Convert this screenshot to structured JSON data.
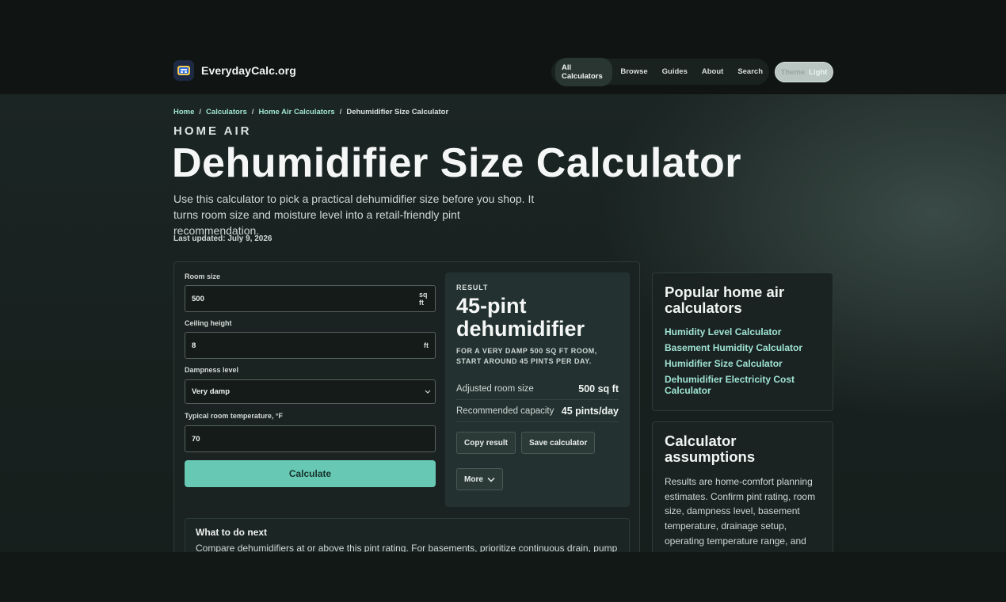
{
  "brand": {
    "name": "EverydayCalc.org"
  },
  "nav": {
    "items": [
      "All Calculators",
      "Browse",
      "Guides",
      "About",
      "Search"
    ],
    "theme_label": "Theme",
    "theme_value": "Light"
  },
  "breadcrumb": {
    "items": [
      "Home",
      "Calculators",
      "Home Air Calculators"
    ],
    "current": "Dehumidifier Size Calculator"
  },
  "hero": {
    "eyebrow": "HOME AIR",
    "title": "Dehumidifier Size Calculator",
    "lede": "Use this calculator to pick a practical dehumidifier size before you shop. It turns room size and moisture level into a retail-friendly pint recommendation.",
    "updated": "Last updated: July 9, 2026"
  },
  "form": {
    "room_size": {
      "label": "Room size",
      "value": "500",
      "unit": "sq ft"
    },
    "ceiling": {
      "label": "Ceiling height",
      "value": "8",
      "unit": "ft"
    },
    "dampness": {
      "label": "Dampness level",
      "value": "Very damp"
    },
    "temperature": {
      "label": "Typical room temperature, °F",
      "value": "70"
    },
    "calculate_label": "Calculate"
  },
  "result": {
    "label": "RESULT",
    "value": "45-pint dehumidifier",
    "note": "FOR A VERY DAMP 500 SQ FT ROOM, START AROUND 45 PINTS PER DAY.",
    "rows": [
      {
        "k": "Adjusted room size",
        "v": "500 sq ft"
      },
      {
        "k": "Recommended capacity",
        "v": "45 pints/day"
      }
    ],
    "copy_label": "Copy result",
    "save_label": "Save calculator",
    "more_label": "More"
  },
  "next": {
    "title": "What to do next",
    "text": "Compare dehumidifiers at or above this pint rating. For basements, prioritize continuous drain, pump"
  },
  "popular": {
    "title": "Popular home air calculators",
    "links": [
      "Humidity Level Calculator",
      "Basement Humidity Calculator",
      "Humidifier Size Calculator",
      "Dehumidifier Electricity Cost Calculator"
    ]
  },
  "assumptions": {
    "title": "Calculator assumptions",
    "text": "Results are home-comfort planning estimates. Confirm pint rating, room size, dampness level, basement temperature, drainage setup, operating temperature range, and humidity conditions before buying."
  },
  "colors": {
    "accent": "#67c9b4",
    "link": "#9fe3d2",
    "background": "#18211f"
  }
}
